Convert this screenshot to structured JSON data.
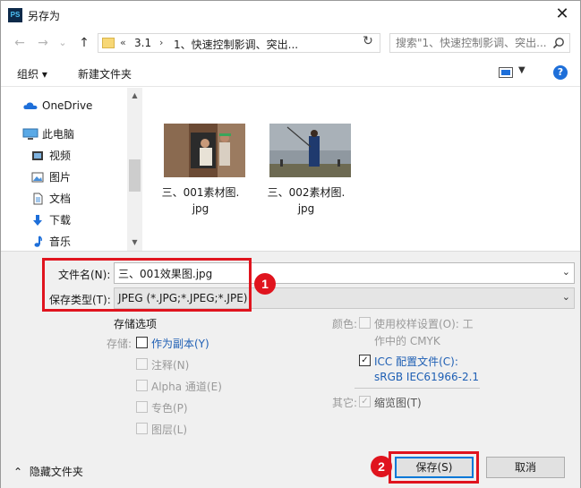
{
  "window": {
    "title": "另存为",
    "app_icon": "PS",
    "close_glyph": "✕"
  },
  "nav": {
    "back_glyph": "←",
    "forward_glyph": "→",
    "history_glyph": "⌄",
    "up_glyph": "↑",
    "address_prefix": "«",
    "address_seg1": "3.1",
    "address_sep": "›",
    "address_seg2": "1、快速控制影调、突出...",
    "address_dropdown": "⌄",
    "refresh_glyph": "↻",
    "search_placeholder": "搜索\"1、快速控制影调、突出..."
  },
  "toolbar": {
    "organize_label": "组织 ▾",
    "new_folder_label": "新建文件夹",
    "view_dropdown": "▼",
    "help_label": "?"
  },
  "sidebar": {
    "items": [
      {
        "label": "OneDrive",
        "icon": "cloud-icon"
      },
      {
        "label": "此电脑",
        "icon": "computer-icon"
      },
      {
        "label": "视频",
        "icon": "video-icon"
      },
      {
        "label": "图片",
        "icon": "picture-icon"
      },
      {
        "label": "文档",
        "icon": "document-icon"
      },
      {
        "label": "下载",
        "icon": "download-icon"
      },
      {
        "label": "音乐",
        "icon": "music-icon"
      }
    ],
    "scroll_up": "▲",
    "scroll_down": "▼"
  },
  "files": [
    {
      "name_line1": "三、001素材图.",
      "name_line2": "jpg"
    },
    {
      "name_line1": "三、002素材图.",
      "name_line2": "jpg"
    }
  ],
  "form": {
    "filename_label": "文件名(N):",
    "filename_value": "三、001效果图.jpg",
    "filetype_label": "保存类型(T):",
    "filetype_value": "JPEG (*.JPG;*.JPEG;*.JPE)",
    "dropdown_glyph": "⌄"
  },
  "badges": {
    "one": "1",
    "two": "2"
  },
  "options": {
    "section_title": "存储选项",
    "save_label": "存储:",
    "as_copy": "作为副本(Y)",
    "notes": "注释(N)",
    "alpha": "Alpha 通道(E)",
    "spot": "专色(P)",
    "layers": "图层(L)",
    "color_label": "颜色:",
    "proof_setup_line1": "使用校样设置(O):  工",
    "proof_setup_line2": "作中的 CMYK",
    "icc_line1": "ICC 配置文件(C):",
    "icc_line2": "sRGB IEC61966-2.1",
    "other_label": "其它:",
    "thumbnail": "缩览图(T)",
    "check_glyph": "✓"
  },
  "footer": {
    "hide_folders": "隐藏文件夹",
    "hide_glyph": "⌃",
    "save_button": "保存(S)",
    "cancel_button": "取消"
  }
}
